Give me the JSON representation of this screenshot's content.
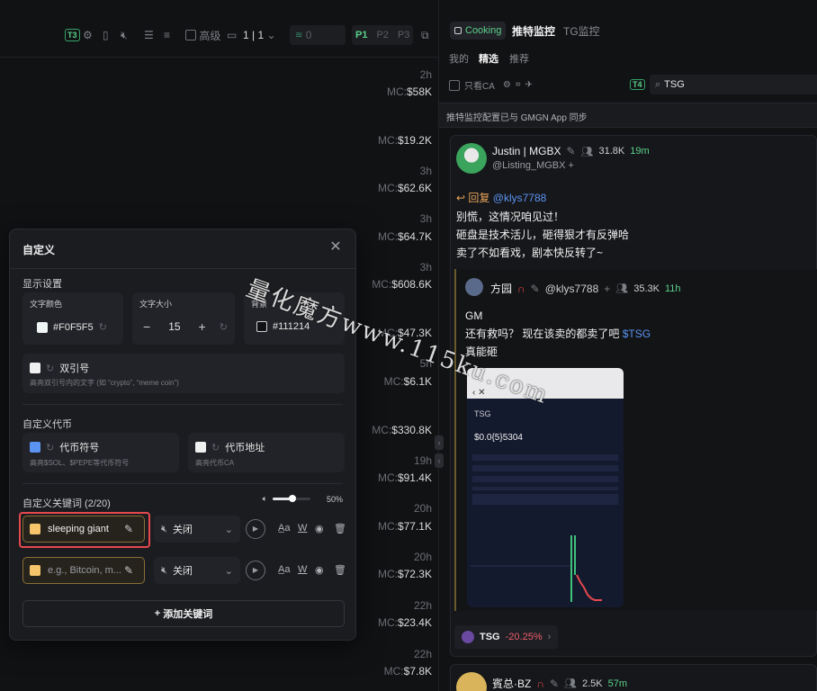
{
  "toolbar": {
    "badge": "T3",
    "advanced_label": "高级",
    "page_current": "1",
    "page_total": "1",
    "amount_placeholder": "0",
    "presets": [
      "P1",
      "P2",
      "P3"
    ]
  },
  "left_rows": [
    {
      "time": "2h",
      "mc_label": "MC:",
      "mc_value": "$58K"
    },
    {
      "time": "",
      "mc_label": "MC:",
      "mc_value": "$19.2K"
    },
    {
      "time": "3h",
      "mc_label": "MC:",
      "mc_value": "$62.6K"
    },
    {
      "time": "3h",
      "mc_label": "MC:",
      "mc_value": "$64.7K"
    },
    {
      "time": "3h",
      "mc_label": "MC:",
      "mc_value": "$608.6K"
    },
    {
      "time": "",
      "mc_label": "MC:",
      "mc_value": "$47.3K"
    },
    {
      "time": "5h",
      "mc_label": "MC:",
      "mc_value": "$6.1K"
    },
    {
      "time": "",
      "mc_label": "MC:",
      "mc_value": "$330.8K"
    },
    {
      "time": "19h",
      "mc_label": "MC:",
      "mc_value": "$91.4K"
    },
    {
      "time": "20h",
      "mc_label": "MC:",
      "mc_value": "$77.1K"
    },
    {
      "time": "20h",
      "mc_label": "MC:",
      "mc_value": "$72.3K"
    },
    {
      "time": "22h",
      "mc_label": "MC:",
      "mc_value": "$23.4K"
    },
    {
      "time": "22h",
      "mc_label": "MC:",
      "mc_value": "$7.8K"
    }
  ],
  "modal": {
    "title": "自定义",
    "display_section": "显示设置",
    "text_color_label": "文字颜色",
    "text_color_value": "#F0F5F5",
    "font_size_label": "文字大小",
    "font_size_value": "15",
    "bg_label": "背景",
    "bg_value": "#111214",
    "quote_label": "双引号",
    "quote_hint": "高亮双引号内的文字 (如 “crypto”, “meme coin”)",
    "token_section": "自定义代币",
    "token_symbol_label": "代币符号",
    "token_symbol_hint": "高亮$SOL、$PEPE等代币符号",
    "token_address_label": "代币地址",
    "token_address_hint": "高亮代币CA",
    "keyword_section": "自定义关键词 (2/20)",
    "volume_value": "50%",
    "keywords": [
      {
        "text": "sleeping giant",
        "placeholder": false,
        "sound": "关闭"
      },
      {
        "text": "e.g., Bitcoin, m...",
        "placeholder": true,
        "sound": "关闭"
      }
    ],
    "add_keyword_label": "添加关键词",
    "colors": {
      "accent_blue": "#5a93f2",
      "keyword_swatch": "#f5c46b",
      "highlight_border": "#e5484d"
    }
  },
  "right": {
    "tabs": [
      {
        "label": "Cooking",
        "active": false,
        "pill": true
      },
      {
        "label": "推特监控",
        "active": true
      },
      {
        "label": "TG监控",
        "active": false
      }
    ],
    "subtabs": [
      {
        "label": "我的",
        "active": false
      },
      {
        "label": "精选",
        "active": true
      },
      {
        "label": "推荐",
        "active": false
      }
    ],
    "only_ca_label": "只看CA",
    "search_badge": "T4",
    "search_value": "TSG",
    "sync_notice": "推特监控配置已与 GMGN App 同步",
    "tweet1": {
      "name": "Justin | MGBX",
      "handle": "@Listing_MGBX",
      "followers": "31.8K",
      "time": "19m",
      "reply_label": "回复",
      "reply_to": "@klys7788",
      "lines": [
        "别慌，这情况咱见过！",
        "砸盘是技术活儿，砸得狠才有反弹哈",
        "卖了不如看戏，剧本快反转了~"
      ]
    },
    "quoted": {
      "name": "方园",
      "handle": "@klys7788",
      "followers": "35.3K",
      "time": "11h",
      "lines": [
        "GM",
        "还有救吗？ 现在该卖的都卖了吧",
        "真能砸"
      ],
      "cashtag": "$TSG",
      "chart_token": "TSG",
      "chart_price": "$0.0{5}5304"
    },
    "token_chip": {
      "symbol": "TSG",
      "change": "-20.25%"
    },
    "tweet2": {
      "name": "賓总·BZ",
      "followers": "2.5K",
      "time": "57m"
    }
  },
  "watermark": "量化魔方www.115ku.com"
}
